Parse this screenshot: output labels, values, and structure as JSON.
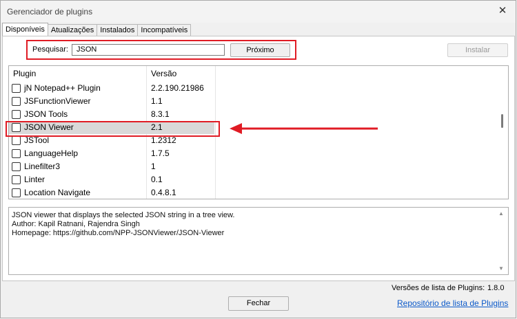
{
  "window": {
    "title": "Gerenciador de plugins",
    "close_glyph": "✕"
  },
  "tabs": [
    {
      "label": "Disponíveis",
      "active": true
    },
    {
      "label": "Atualizações",
      "active": false
    },
    {
      "label": "Instalados",
      "active": false
    },
    {
      "label": "Incompatíveis",
      "active": false
    }
  ],
  "search": {
    "label": "Pesquisar:",
    "value": "JSON",
    "next_label": "Próximo"
  },
  "install_label": "Instalar",
  "list": {
    "col_plugin": "Plugin",
    "col_version": "Versão",
    "rows": [
      {
        "name": "jN Notepad++ Plugin",
        "version": "2.2.190.21986",
        "checked": false,
        "selected": false
      },
      {
        "name": "JSFunctionViewer",
        "version": "1.1",
        "checked": false,
        "selected": false
      },
      {
        "name": "JSON Tools",
        "version": "8.3.1",
        "checked": false,
        "selected": false
      },
      {
        "name": "JSON Viewer",
        "version": "2.1",
        "checked": false,
        "selected": true
      },
      {
        "name": "JSTool",
        "version": "1.2312",
        "checked": false,
        "selected": false
      },
      {
        "name": "LanguageHelp",
        "version": "1.7.5",
        "checked": false,
        "selected": false
      },
      {
        "name": "Linefilter3",
        "version": "1",
        "checked": false,
        "selected": false
      },
      {
        "name": "Linter",
        "version": "0.1",
        "checked": false,
        "selected": false
      },
      {
        "name": "Location Navigate",
        "version": "0.4.8.1",
        "checked": false,
        "selected": false
      }
    ]
  },
  "description": {
    "lines": [
      "JSON viewer that displays the selected JSON string in a tree view.",
      "Author: Kapil Ratnani, Rajendra Singh",
      "Homepage: https://github.com/NPP-JSONViewer/JSON-Viewer"
    ]
  },
  "footer": {
    "versions_label": "Versões de lista de Plugins:",
    "versions_value": "1.8.0",
    "close_label": "Fechar",
    "repo_link": "Repositório de lista de Plugins"
  },
  "colors": {
    "highlight": "#e01b24",
    "link": "#0b59c9",
    "selected_row": "#d9d9d9"
  },
  "icons": {
    "close": "close-icon",
    "arrow": "arrow-left-icon"
  }
}
